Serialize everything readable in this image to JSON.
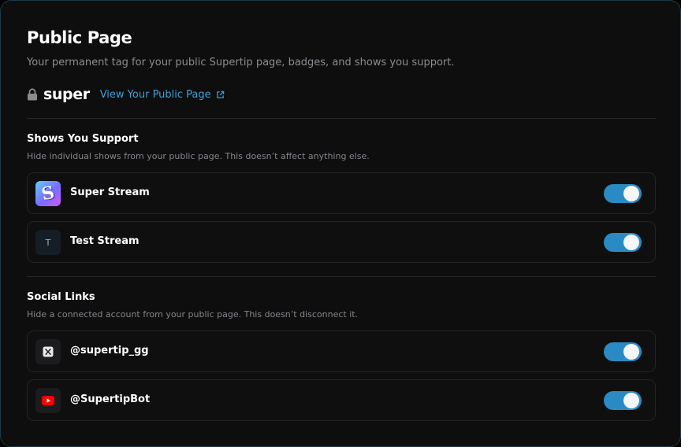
{
  "header": {
    "title": "Public Page",
    "subtitle": "Your permanent tag for your public Supertip page, badges, and shows you support."
  },
  "tag": {
    "name": "super",
    "view_link": "View Your Public Page"
  },
  "shows": {
    "title": "Shows You Support",
    "description": "Hide individual shows from your public page. This doesn’t affect anything else.",
    "items": [
      {
        "label": "Super Stream",
        "icon": "super-stream-logo",
        "icon_text": "S",
        "enabled": true
      },
      {
        "label": "Test Stream",
        "icon": "letter-avatar",
        "icon_text": "T",
        "enabled": true
      }
    ]
  },
  "social": {
    "title": "Social Links",
    "description": "Hide a connected account from your public page. This doesn’t disconnect it.",
    "items": [
      {
        "label": "@supertip_gg",
        "icon": "x-twitter-icon",
        "enabled": true
      },
      {
        "label": "@SupertipBot",
        "icon": "youtube-icon",
        "enabled": true
      }
    ]
  },
  "colors": {
    "accent": "#3d9fd8",
    "toggle_on": "#2a8bc4",
    "youtube_red": "#ff0000"
  }
}
